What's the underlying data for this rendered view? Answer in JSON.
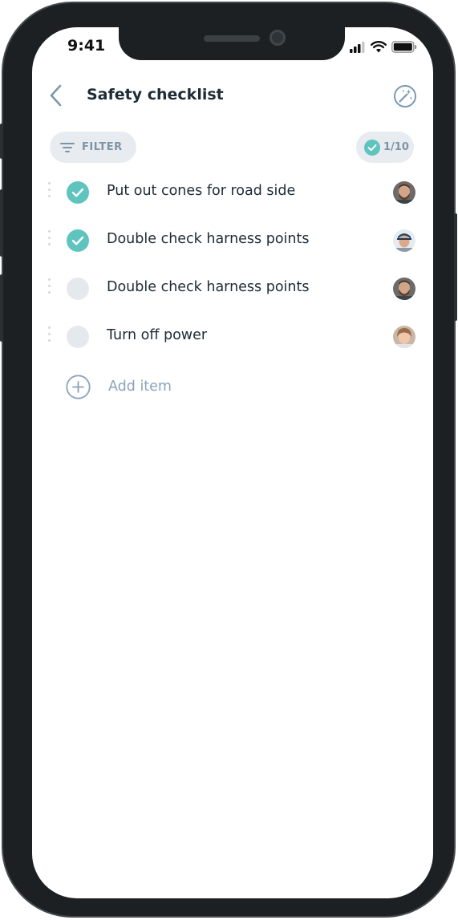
{
  "status_bar": {
    "time": "9:41"
  },
  "header": {
    "title": "Safety checklist",
    "back_icon": "chevron-left-icon",
    "action_icon": "magic-wand-icon"
  },
  "toolbar": {
    "filter_label": "FILTER",
    "progress_label": "1/10"
  },
  "items": [
    {
      "label": "Put out cones for road side",
      "done": true
    },
    {
      "label": "Double check harness points",
      "done": true
    },
    {
      "label": "Double check harness points",
      "done": false
    },
    {
      "label": "Turn off power",
      "done": false
    }
  ],
  "add_item": {
    "label": "Add item"
  },
  "colors": {
    "accent": "#5fc4bd",
    "text": "#1d2b36",
    "muted": "#8aa3bb",
    "chip_bg": "#e8ecf0"
  }
}
